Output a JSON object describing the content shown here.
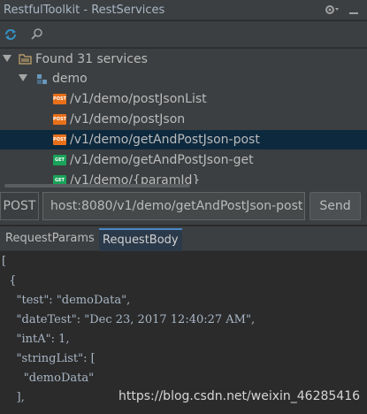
{
  "window": {
    "title": "RestfulToolkit - RestServices"
  },
  "toolbar": {
    "refresh_icon": "refresh-icon",
    "search_icon": "search-icon"
  },
  "tree": {
    "root_label": "Found 31 services",
    "module_label": "demo",
    "services": [
      {
        "method": "POST",
        "path": "/v1/demo/postJsonList",
        "selected": false
      },
      {
        "method": "POST",
        "path": "/v1/demo/postJson",
        "selected": false
      },
      {
        "method": "POST",
        "path": "/v1/demo/getAndPostJson-post",
        "selected": true
      },
      {
        "method": "GET",
        "path": "/v1/demo/getAndPostJson-get",
        "selected": false
      },
      {
        "method": "GET",
        "path": "/v1/demo/{paramId}",
        "selected": false
      }
    ]
  },
  "request": {
    "method": "POST",
    "url": "host:8080/v1/demo/getAndPostJson-post",
    "send_label": "Send"
  },
  "tabs": [
    {
      "label": "RequestParams",
      "active": false
    },
    {
      "label": "RequestBody",
      "active": true
    }
  ],
  "body_lines": [
    "[",
    "  {",
    "    \"test\": \"demoData\",",
    "    \"dateTest\": \"Dec 23, 2017 12:40:27 AM\",",
    "    \"intA\": 1,",
    "    \"stringList\": [",
    "      \"demoData\"",
    "    ],"
  ],
  "watermark": "https://blog.csdn.net/weixin_46285416",
  "colors": {
    "post_badge": "#e8701a",
    "get_badge": "#1aa35a",
    "selection": "#0d293e",
    "active_tab": "#2b3a4a"
  }
}
